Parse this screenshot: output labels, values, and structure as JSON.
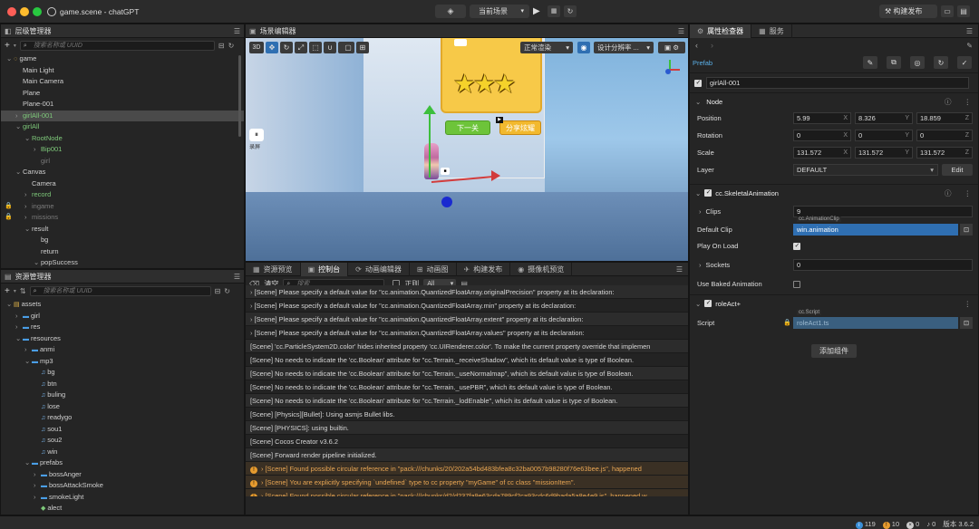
{
  "titlebar": {
    "title": "game.scene - chatGPT",
    "scene_select": "当前场景",
    "build_label": "构建发布"
  },
  "hierarchy": {
    "title": "层级管理器",
    "search_placeholder": "搜索名称或 UUID",
    "items": [
      {
        "label": "game",
        "indent": 0,
        "caret": "v",
        "style": "normal",
        "icon": "scene"
      },
      {
        "label": "Main Light",
        "indent": 1,
        "caret": "",
        "style": "normal"
      },
      {
        "label": "Main Camera",
        "indent": 1,
        "caret": "",
        "style": "normal"
      },
      {
        "label": "Plane",
        "indent": 1,
        "caret": "",
        "style": "normal"
      },
      {
        "label": "Plane-001",
        "indent": 1,
        "caret": "",
        "style": "normal"
      },
      {
        "label": "girlAll-001",
        "indent": 1,
        "caret": ">",
        "style": "green-sel"
      },
      {
        "label": "girlAll",
        "indent": 1,
        "caret": "v",
        "style": "green"
      },
      {
        "label": "RootNode",
        "indent": 2,
        "caret": "v",
        "style": "green"
      },
      {
        "label": "Bip001",
        "indent": 3,
        "caret": ">",
        "style": "green"
      },
      {
        "label": "girl",
        "indent": 3,
        "caret": "",
        "style": "dim"
      },
      {
        "label": "Canvas",
        "indent": 1,
        "caret": "v",
        "style": "normal"
      },
      {
        "label": "Camera",
        "indent": 2,
        "caret": "",
        "style": "normal"
      },
      {
        "label": "record",
        "indent": 2,
        "caret": ">",
        "style": "green"
      },
      {
        "label": "ingame",
        "indent": 2,
        "caret": ">",
        "style": "dim",
        "lock": true
      },
      {
        "label": "missions",
        "indent": 2,
        "caret": ">",
        "style": "dim",
        "lock": true
      },
      {
        "label": "result",
        "indent": 2,
        "caret": "v",
        "style": "normal"
      },
      {
        "label": "bg",
        "indent": 3,
        "caret": "",
        "style": "normal"
      },
      {
        "label": "return",
        "indent": 3,
        "caret": "",
        "style": "normal"
      },
      {
        "label": "popSuccess",
        "indent": 3,
        "caret": "v",
        "style": "normal"
      }
    ]
  },
  "assets": {
    "title": "资源管理器",
    "search_placeholder": "搜索名称或 UUID",
    "items": [
      {
        "label": "assets",
        "indent": 0,
        "caret": "v",
        "icon": "db"
      },
      {
        "label": "girl",
        "indent": 1,
        "caret": ">",
        "icon": "folder"
      },
      {
        "label": "res",
        "indent": 1,
        "caret": ">",
        "icon": "folder"
      },
      {
        "label": "resources",
        "indent": 1,
        "caret": "v",
        "icon": "folder"
      },
      {
        "label": "anmi",
        "indent": 2,
        "caret": ">",
        "icon": "folder"
      },
      {
        "label": "mp3",
        "indent": 2,
        "caret": "v",
        "icon": "folder"
      },
      {
        "label": "bg",
        "indent": 3,
        "caret": "",
        "icon": "note"
      },
      {
        "label": "btn",
        "indent": 3,
        "caret": "",
        "icon": "note"
      },
      {
        "label": "buling",
        "indent": 3,
        "caret": "",
        "icon": "note"
      },
      {
        "label": "lose",
        "indent": 3,
        "caret": "",
        "icon": "note"
      },
      {
        "label": "readygo",
        "indent": 3,
        "caret": "",
        "icon": "note"
      },
      {
        "label": "sou1",
        "indent": 3,
        "caret": "",
        "icon": "note"
      },
      {
        "label": "sou2",
        "indent": 3,
        "caret": "",
        "icon": "note"
      },
      {
        "label": "win",
        "indent": 3,
        "caret": "",
        "icon": "note"
      },
      {
        "label": "prefabs",
        "indent": 2,
        "caret": "v",
        "icon": "folder"
      },
      {
        "label": "bossAnger",
        "indent": 3,
        "caret": ">",
        "icon": "folder"
      },
      {
        "label": "bossAttackSmoke",
        "indent": 3,
        "caret": ">",
        "icon": "folder"
      },
      {
        "label": "smokeLight",
        "indent": 3,
        "caret": ">",
        "icon": "folder"
      },
      {
        "label": "alect",
        "indent": 3,
        "caret": "",
        "icon": "prefab"
      }
    ]
  },
  "scene_editor": {
    "title": "场景编辑器",
    "mode_3d": "3D",
    "render_mode": "正常渲染",
    "resolution": "设计分辨率 ...",
    "btn_next": "下一关",
    "btn_share": "分享炫耀",
    "side_label": "录屏"
  },
  "bottom_tabs": [
    {
      "label": "资源预览",
      "icon": "▦"
    },
    {
      "label": "控制台",
      "icon": "▣",
      "active": true
    },
    {
      "label": "动画编辑器",
      "icon": "⟳"
    },
    {
      "label": "动画图",
      "icon": "⊞"
    },
    {
      "label": "构建发布",
      "icon": "✈"
    },
    {
      "label": "摄像机预览",
      "icon": "◉"
    }
  ],
  "console": {
    "clear_label": "清空",
    "search_placeholder": "搜索",
    "regex_label": "正则",
    "filter": "All",
    "lines": [
      {
        "text": "[Scene] Please specify a default value for \"cc.animation.QuantizedFloatArray.originalPrecision\" property at its declaration:",
        "kind": "expand"
      },
      {
        "text": "[Scene] Please specify a default value for \"cc.animation.QuantizedFloatArray.min\" property at its declaration:",
        "kind": "expand"
      },
      {
        "text": "[Scene] Please specify a default value for \"cc.animation.QuantizedFloatArray.extent\" property at its declaration:",
        "kind": "expand"
      },
      {
        "text": "[Scene] Please specify a default value for \"cc.animation.QuantizedFloatArray.values\" property at its declaration:",
        "kind": "expand"
      },
      {
        "text": "[Scene] 'cc.ParticleSystem2D.color' hides inherited property 'cc.UIRenderer.color'. To make the current property override that implemen",
        "kind": "plain"
      },
      {
        "text": "[Scene] No needs to indicate the 'cc.Boolean' attribute for \"cc.Terrain._receiveShadow\", which its default value is type of Boolean.",
        "kind": "plain"
      },
      {
        "text": "[Scene] No needs to indicate the 'cc.Boolean' attribute for \"cc.Terrain._useNormalmap\", which its default value is type of Boolean.",
        "kind": "plain"
      },
      {
        "text": "[Scene] No needs to indicate the 'cc.Boolean' attribute for \"cc.Terrain._usePBR\", which its default value is type of Boolean.",
        "kind": "plain"
      },
      {
        "text": "[Scene] No needs to indicate the 'cc.Boolean' attribute for \"cc.Terrain._lodEnable\", which its default value is type of Boolean.",
        "kind": "plain"
      },
      {
        "text": "[Scene] [Physics][Bullet]: Using asmjs Bullet libs.",
        "kind": "plain"
      },
      {
        "text": "[Scene] [PHYSICS]: using builtin.",
        "kind": "plain"
      },
      {
        "text": "[Scene] Cocos Creator v3.6.2",
        "kind": "plain"
      },
      {
        "text": "[Scene] Forward render pipeline initialized.",
        "kind": "plain"
      },
      {
        "text": "[Scene] Found possible circular reference in \"pack:///chunks/20/202a54bd483bfea8c32ba0057b98280f76e63bee.js\", happened",
        "kind": "warn"
      },
      {
        "text": "[Scene] You are explicitly specifying `undefined` type to cc property \"myGame\" of cc class \"missionItem\".",
        "kind": "warn"
      },
      {
        "text": "[Scene] Found possible circular reference in \"pack:///chunks/d2/d237fa9e63cda789cf2ca93cdc6d9bada5a8e4e9.js\", happened w",
        "kind": "warn"
      }
    ]
  },
  "inspector": {
    "tab_inspector": "属性检查器",
    "tab_service": "服务",
    "prefab_label": "Prefab",
    "node_name": "girlAll-001",
    "node_section": "Node",
    "position_label": "Position",
    "position": {
      "x": "5.99",
      "y": "8.326",
      "z": "18.859"
    },
    "rotation_label": "Rotation",
    "rotation": {
      "x": "0",
      "y": "0",
      "z": "0"
    },
    "scale_label": "Scale",
    "scale": {
      "x": "131.572",
      "y": "131.572",
      "z": "131.572"
    },
    "layer_label": "Layer",
    "layer_value": "DEFAULT",
    "layer_edit": "Edit",
    "axis_x": "X",
    "axis_y": "Y",
    "axis_z": "Z",
    "skeletal_section": "cc.SkeletalAnimation",
    "clips_label": "Clips",
    "clips_value": "9",
    "default_clip_label": "Default Clip",
    "clip_type_tag": "cc.AnimationClip",
    "default_clip_value": "win.animation",
    "play_on_load_label": "Play On Load",
    "sockets_label": "Sockets",
    "sockets_value": "0",
    "use_baked_label": "Use Baked Animation",
    "role_section": "roleAct+",
    "script_label": "Script",
    "script_type_tag": "cc.Script",
    "script_value": "roleAct1.ts",
    "add_component": "添加组件"
  },
  "statusbar": {
    "info_count": "119",
    "warn_count": "10",
    "error_count": "0",
    "notice_count": "0",
    "version": "版本 3.6.2"
  },
  "colors": {
    "accent_blue": "#2f6fb2",
    "green_node": "#7ec97a",
    "warn_orange": "#e69b2f",
    "button_green": "#6dc43a",
    "button_yellow": "#f2b92e"
  }
}
